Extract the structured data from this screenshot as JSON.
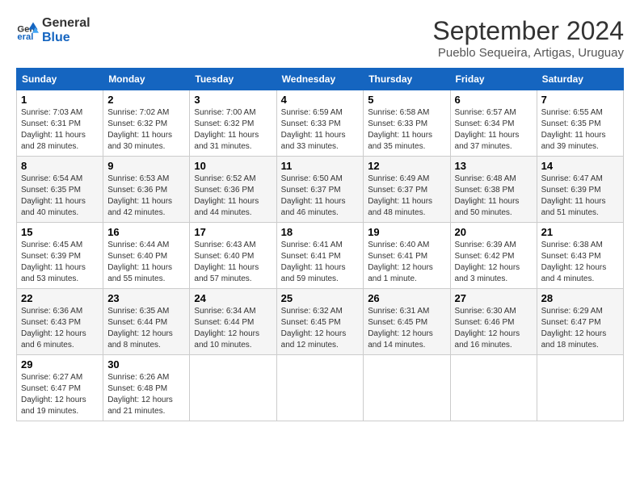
{
  "header": {
    "logo_line1": "General",
    "logo_line2": "Blue",
    "month_year": "September 2024",
    "location": "Pueblo Sequeira, Artigas, Uruguay"
  },
  "weekdays": [
    "Sunday",
    "Monday",
    "Tuesday",
    "Wednesday",
    "Thursday",
    "Friday",
    "Saturday"
  ],
  "weeks": [
    [
      {
        "day": "1",
        "sunrise": "7:03 AM",
        "sunset": "6:31 PM",
        "daylight": "11 hours and 28 minutes."
      },
      {
        "day": "2",
        "sunrise": "7:02 AM",
        "sunset": "6:32 PM",
        "daylight": "11 hours and 30 minutes."
      },
      {
        "day": "3",
        "sunrise": "7:00 AM",
        "sunset": "6:32 PM",
        "daylight": "11 hours and 31 minutes."
      },
      {
        "day": "4",
        "sunrise": "6:59 AM",
        "sunset": "6:33 PM",
        "daylight": "11 hours and 33 minutes."
      },
      {
        "day": "5",
        "sunrise": "6:58 AM",
        "sunset": "6:33 PM",
        "daylight": "11 hours and 35 minutes."
      },
      {
        "day": "6",
        "sunrise": "6:57 AM",
        "sunset": "6:34 PM",
        "daylight": "11 hours and 37 minutes."
      },
      {
        "day": "7",
        "sunrise": "6:55 AM",
        "sunset": "6:35 PM",
        "daylight": "11 hours and 39 minutes."
      }
    ],
    [
      {
        "day": "8",
        "sunrise": "6:54 AM",
        "sunset": "6:35 PM",
        "daylight": "11 hours and 40 minutes."
      },
      {
        "day": "9",
        "sunrise": "6:53 AM",
        "sunset": "6:36 PM",
        "daylight": "11 hours and 42 minutes."
      },
      {
        "day": "10",
        "sunrise": "6:52 AM",
        "sunset": "6:36 PM",
        "daylight": "11 hours and 44 minutes."
      },
      {
        "day": "11",
        "sunrise": "6:50 AM",
        "sunset": "6:37 PM",
        "daylight": "11 hours and 46 minutes."
      },
      {
        "day": "12",
        "sunrise": "6:49 AM",
        "sunset": "6:37 PM",
        "daylight": "11 hours and 48 minutes."
      },
      {
        "day": "13",
        "sunrise": "6:48 AM",
        "sunset": "6:38 PM",
        "daylight": "11 hours and 50 minutes."
      },
      {
        "day": "14",
        "sunrise": "6:47 AM",
        "sunset": "6:39 PM",
        "daylight": "11 hours and 51 minutes."
      }
    ],
    [
      {
        "day": "15",
        "sunrise": "6:45 AM",
        "sunset": "6:39 PM",
        "daylight": "11 hours and 53 minutes."
      },
      {
        "day": "16",
        "sunrise": "6:44 AM",
        "sunset": "6:40 PM",
        "daylight": "11 hours and 55 minutes."
      },
      {
        "day": "17",
        "sunrise": "6:43 AM",
        "sunset": "6:40 PM",
        "daylight": "11 hours and 57 minutes."
      },
      {
        "day": "18",
        "sunrise": "6:41 AM",
        "sunset": "6:41 PM",
        "daylight": "11 hours and 59 minutes."
      },
      {
        "day": "19",
        "sunrise": "6:40 AM",
        "sunset": "6:41 PM",
        "daylight": "12 hours and 1 minute."
      },
      {
        "day": "20",
        "sunrise": "6:39 AM",
        "sunset": "6:42 PM",
        "daylight": "12 hours and 3 minutes."
      },
      {
        "day": "21",
        "sunrise": "6:38 AM",
        "sunset": "6:43 PM",
        "daylight": "12 hours and 4 minutes."
      }
    ],
    [
      {
        "day": "22",
        "sunrise": "6:36 AM",
        "sunset": "6:43 PM",
        "daylight": "12 hours and 6 minutes."
      },
      {
        "day": "23",
        "sunrise": "6:35 AM",
        "sunset": "6:44 PM",
        "daylight": "12 hours and 8 minutes."
      },
      {
        "day": "24",
        "sunrise": "6:34 AM",
        "sunset": "6:44 PM",
        "daylight": "12 hours and 10 minutes."
      },
      {
        "day": "25",
        "sunrise": "6:32 AM",
        "sunset": "6:45 PM",
        "daylight": "12 hours and 12 minutes."
      },
      {
        "day": "26",
        "sunrise": "6:31 AM",
        "sunset": "6:45 PM",
        "daylight": "12 hours and 14 minutes."
      },
      {
        "day": "27",
        "sunrise": "6:30 AM",
        "sunset": "6:46 PM",
        "daylight": "12 hours and 16 minutes."
      },
      {
        "day": "28",
        "sunrise": "6:29 AM",
        "sunset": "6:47 PM",
        "daylight": "12 hours and 18 minutes."
      }
    ],
    [
      {
        "day": "29",
        "sunrise": "6:27 AM",
        "sunset": "6:47 PM",
        "daylight": "12 hours and 19 minutes."
      },
      {
        "day": "30",
        "sunrise": "6:26 AM",
        "sunset": "6:48 PM",
        "daylight": "12 hours and 21 minutes."
      },
      null,
      null,
      null,
      null,
      null
    ]
  ]
}
